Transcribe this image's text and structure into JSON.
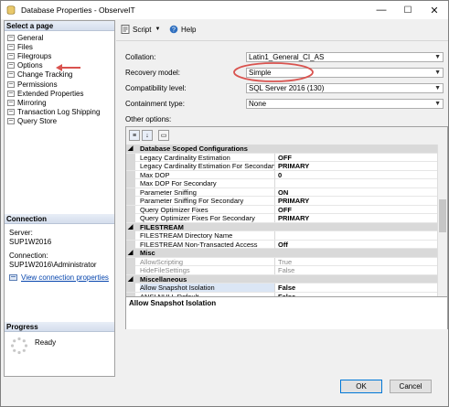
{
  "window": {
    "title": "Database Properties - ObserveIT",
    "min_glyph": "—",
    "max_glyph": "☐",
    "close_glyph": "✕"
  },
  "sidebar": {
    "section_label": "Select a page",
    "pages": [
      "General",
      "Files",
      "Filegroups",
      "Options",
      "Change Tracking",
      "Permissions",
      "Extended Properties",
      "Mirroring",
      "Transaction Log Shipping",
      "Query Store"
    ],
    "connection": {
      "heading": "Connection",
      "server_label": "Server:",
      "server_value": "SUP1W2016",
      "connection_label": "Connection:",
      "connection_value": "SUP1W2016\\Administrator",
      "view_link": "View connection properties"
    },
    "progress": {
      "heading": "Progress",
      "status": "Ready"
    }
  },
  "toolbar": {
    "script_label": "Script",
    "help_label": "Help"
  },
  "form": {
    "collation_label": "Collation:",
    "collation_value": "Latin1_General_CI_AS",
    "recovery_label": "Recovery model:",
    "recovery_value": "Simple",
    "compat_label": "Compatibility level:",
    "compat_value": "SQL Server 2016 (130)",
    "containment_label": "Containment type:",
    "containment_value": "None",
    "other_label": "Other options:"
  },
  "grid": {
    "rows": [
      {
        "type": "cat",
        "name": "Database Scoped Configurations"
      },
      {
        "type": "prop",
        "name": "Legacy Cardinality Estimation",
        "value": "OFF",
        "bold": true
      },
      {
        "type": "prop",
        "name": "Legacy Cardinality Estimation For Secondary",
        "value": "PRIMARY",
        "bold": true
      },
      {
        "type": "prop",
        "name": "Max DOP",
        "value": "0",
        "bold": true
      },
      {
        "type": "prop",
        "name": "Max DOP For Secondary",
        "value": ""
      },
      {
        "type": "prop",
        "name": "Parameter Sniffing",
        "value": "ON",
        "bold": true
      },
      {
        "type": "prop",
        "name": "Parameter Sniffing For Secondary",
        "value": "PRIMARY",
        "bold": true
      },
      {
        "type": "prop",
        "name": "Query Optimizer Fixes",
        "value": "OFF",
        "bold": true
      },
      {
        "type": "prop",
        "name": "Query Optimizer Fixes For Secondary",
        "value": "PRIMARY",
        "bold": true
      },
      {
        "type": "cat",
        "name": "FILESTREAM"
      },
      {
        "type": "prop",
        "name": "FILESTREAM Directory Name",
        "value": ""
      },
      {
        "type": "prop",
        "name": "FILESTREAM Non-Transacted Access",
        "value": "Off",
        "bold": true
      },
      {
        "type": "cat",
        "name": "Misc"
      },
      {
        "type": "prop",
        "name": "AllowScripting",
        "value": "True",
        "disabled": true
      },
      {
        "type": "prop",
        "name": "HideFileSettings",
        "value": "False",
        "disabled": true
      },
      {
        "type": "cat",
        "name": "Miscellaneous"
      },
      {
        "type": "prop",
        "name": "Allow Snapshot Isolation",
        "value": "False",
        "bold": true,
        "selected": true
      },
      {
        "type": "prop",
        "name": "ANSI NULL Default",
        "value": "False",
        "bold": true
      }
    ],
    "description_title": "Allow Snapshot Isolation"
  },
  "buttons": {
    "ok": "OK",
    "cancel": "Cancel"
  },
  "colors": {
    "link": "#0645ad",
    "category_bg": "#d9d9d9",
    "annotation": "#d9534f"
  }
}
